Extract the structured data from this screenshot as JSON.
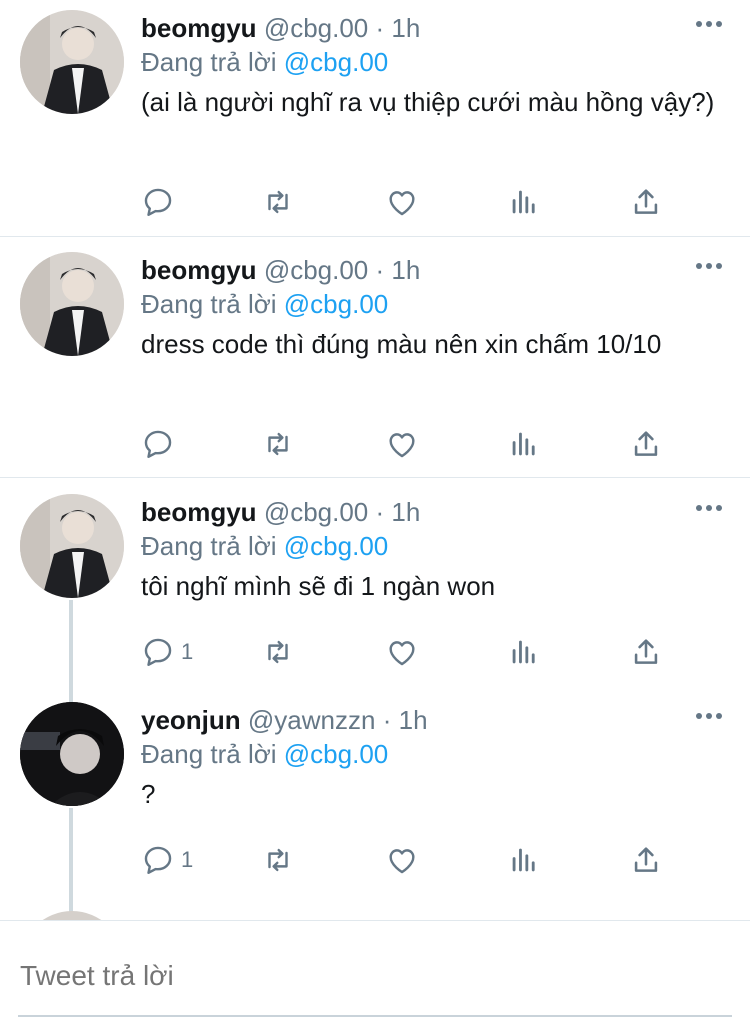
{
  "tweets": [
    {
      "name": "beomgyu",
      "handle": "@cbg.00",
      "dot": "·",
      "time": "1h",
      "reply_prefix": "Đang trả lời ",
      "reply_to": "@cbg.00",
      "text": "(ai là người nghĩ ra vụ thiệp cưới màu hồng vậy?)",
      "reply_count": "",
      "avatar": "light"
    },
    {
      "name": "beomgyu",
      "handle": "@cbg.00",
      "dot": "·",
      "time": "1h",
      "reply_prefix": "Đang trả lời ",
      "reply_to": "@cbg.00",
      "text": "dress code thì đúng màu nên xin chấm 10/10",
      "reply_count": "",
      "avatar": "light"
    },
    {
      "name": "beomgyu",
      "handle": "@cbg.00",
      "dot": "·",
      "time": "1h",
      "reply_prefix": "Đang trả lời ",
      "reply_to": "@cbg.00",
      "text": "tôi nghĩ mình sẽ đi 1 ngàn won",
      "reply_count": "1",
      "avatar": "light"
    },
    {
      "name": "yeonjun",
      "handle": "@yawnzzn",
      "dot": "·",
      "time": "1h",
      "reply_prefix": "Đang trả lời ",
      "reply_to": "@cbg.00",
      "text": "?",
      "reply_count": "1",
      "avatar": "dark"
    }
  ],
  "composer": {
    "placeholder": "Tweet trả lời"
  },
  "icons": {
    "reply": "reply-icon",
    "retweet": "retweet-icon",
    "like": "heart-icon",
    "analytics": "analytics-icon",
    "share": "share-icon",
    "more": "more-icon"
  },
  "colors": {
    "mention": "#1da1f2",
    "secondary_text": "#657786",
    "icon": "#657786"
  }
}
